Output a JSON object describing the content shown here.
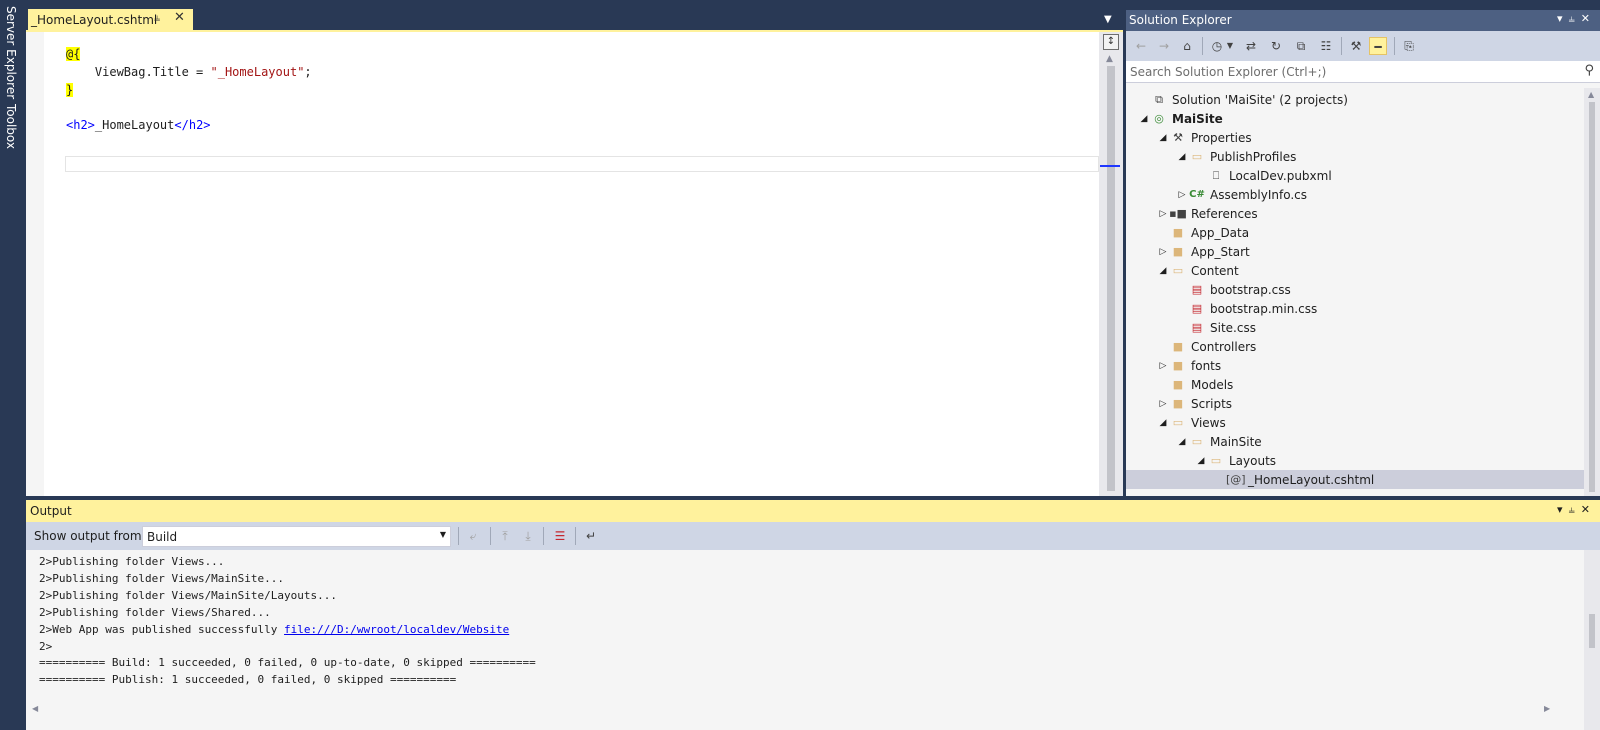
{
  "side_tabs": [
    "Server Explorer",
    "Toolbox"
  ],
  "editor": {
    "tab_title": "_HomeLayout.cshtml",
    "pin_icon": "pin-icon",
    "close_icon": "close-icon",
    "code": {
      "l1_razor": "@{",
      "l2_pre": "    ViewBag.Title = ",
      "l2_str": "\"_HomeLayout\"",
      "l2_end": ";",
      "l3_razor": "}",
      "l5_open": "<h2>",
      "l5_text": "_HomeLayout",
      "l5_close": "</h2>"
    }
  },
  "solution_explorer": {
    "title": "Solution Explorer",
    "search_placeholder": "Search Solution Explorer (Ctrl+;)",
    "tree": [
      {
        "label": "Solution 'MaiSite' (2 projects)",
        "icon": "solution-icon",
        "expanded": null,
        "level": 0
      },
      {
        "label": "MaiSite",
        "icon": "web-project-icon",
        "expanded": true,
        "level": 0,
        "bold": true
      },
      {
        "label": "Properties",
        "icon": "wrench-icon",
        "expanded": true,
        "level": 1
      },
      {
        "label": "PublishProfiles",
        "icon": "folder-open-icon",
        "expanded": true,
        "level": 2
      },
      {
        "label": "LocalDev.pubxml",
        "icon": "file-icon",
        "expanded": null,
        "level": 3
      },
      {
        "label": "AssemblyInfo.cs",
        "icon": "csharp-icon",
        "expanded": false,
        "level": 2
      },
      {
        "label": "References",
        "icon": "references-icon",
        "expanded": false,
        "level": 1
      },
      {
        "label": "App_Data",
        "icon": "folder-icon",
        "expanded": null,
        "level": 1
      },
      {
        "label": "App_Start",
        "icon": "folder-icon",
        "expanded": false,
        "level": 1
      },
      {
        "label": "Content",
        "icon": "folder-open-icon",
        "expanded": true,
        "level": 1
      },
      {
        "label": "bootstrap.css",
        "icon": "css-file-icon",
        "expanded": null,
        "level": 2
      },
      {
        "label": "bootstrap.min.css",
        "icon": "css-file-icon",
        "expanded": null,
        "level": 2
      },
      {
        "label": "Site.css",
        "icon": "css-file-icon",
        "expanded": null,
        "level": 2
      },
      {
        "label": "Controllers",
        "icon": "folder-icon",
        "expanded": null,
        "level": 1
      },
      {
        "label": "fonts",
        "icon": "folder-icon",
        "expanded": false,
        "level": 1
      },
      {
        "label": "Models",
        "icon": "folder-icon",
        "expanded": null,
        "level": 1
      },
      {
        "label": "Scripts",
        "icon": "folder-icon",
        "expanded": false,
        "level": 1
      },
      {
        "label": "Views",
        "icon": "folder-open-icon",
        "expanded": true,
        "level": 1
      },
      {
        "label": "MainSite",
        "icon": "folder-open-icon",
        "expanded": true,
        "level": 2
      },
      {
        "label": "Layouts",
        "icon": "folder-open-icon",
        "expanded": true,
        "level": 3
      },
      {
        "label": "_HomeLayout.cshtml",
        "icon": "razor-file-icon",
        "expanded": null,
        "level": 4,
        "selected": true
      }
    ]
  },
  "output": {
    "title": "Output",
    "show_from_label": "Show output from:",
    "source_selected": "Build",
    "lines": [
      "2>Publishing folder Views...",
      "2>Publishing folder Views/MainSite...",
      "2>Publishing folder Views/MainSite/Layouts...",
      "2>Publishing folder Views/Shared...",
      "2>Web App was published successfully ",
      "2>",
      "========== Build: 1 succeeded, 0 failed, 0 up-to-date, 0 skipped ==========",
      "========== Publish: 1 succeeded, 0 failed, 0 skipped =========="
    ],
    "link": "file:///D:/wwroot/localdev/Website"
  },
  "colors": {
    "chrome": "#293955",
    "active_tab": "#fff29d",
    "se_titlebar": "#4d6082",
    "toolbar": "#cfd6e5",
    "selection": "#cccedb"
  }
}
